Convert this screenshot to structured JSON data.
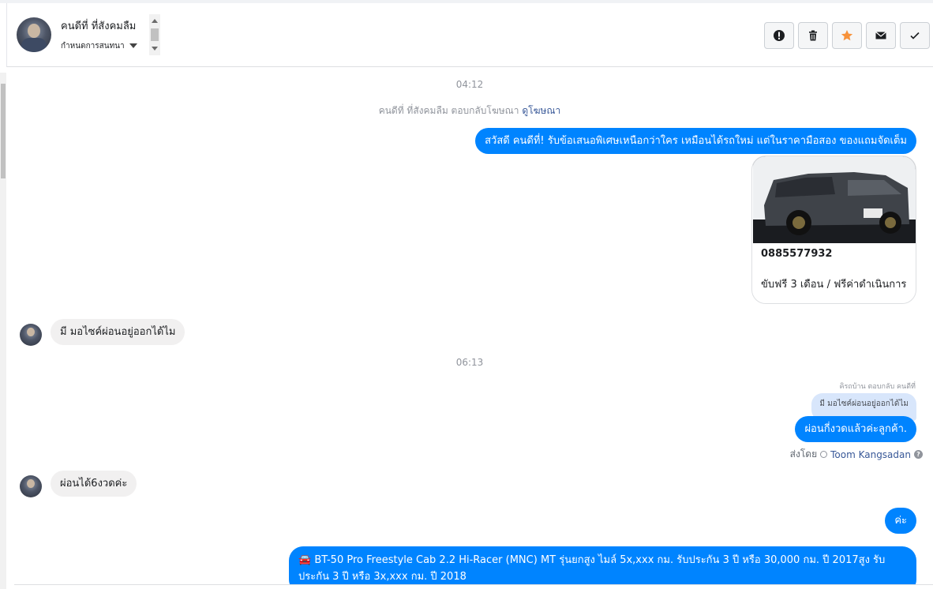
{
  "header": {
    "contact_name": "คนดีที่ ที่สังคมลืม",
    "assign_label": "กำหนดการสนทนา",
    "actions": [
      {
        "name": "spam-button",
        "icon": "exclamation-icon"
      },
      {
        "name": "delete-button",
        "icon": "trash-icon"
      },
      {
        "name": "star-button",
        "icon": "star-icon"
      },
      {
        "name": "mark-unread-button",
        "icon": "envelope-icon"
      },
      {
        "name": "mark-done-button",
        "icon": "check-icon"
      }
    ]
  },
  "colors": {
    "accent": "#0084ff",
    "star": "#f7923b",
    "incoming": "#f1f0f0"
  },
  "conversation": {
    "time1": "04:12",
    "ad_reply_text": "คนดีที่ ที่สังคมลืม ตอบกลับโฆษณา",
    "ad_link": "ดูโฆษณา",
    "msg1": "สวัสดี คนดีที่! รับข้อเสนอพิเศษเหนือกว่าใคร เหมือนได้รถใหม่ แต่ในราคามือสอง ของแถมจัดเต็ม",
    "card": {
      "title": "0885577932",
      "description": "ขับฟรี 3 เดือน / ฟรีค่าดำเนินการ"
    },
    "msg2": "มี มอไซค์ผ่อนอยู่ออกได้ไม",
    "time2": "06:13",
    "reply_meta": "คิรถบ้าน ตอบกลับ คนดีที่",
    "quoted": "มี มอไซค์ผ่อนอยู่ออกได้ไม",
    "msg3": "ผ่อนกี่งวดแล้วค่ะลูกค้า.",
    "sent_by_label": "ส่งโดย",
    "sender": "Toom Kangsadan",
    "msg4": "ผ่อนได้6งวดค่ะ",
    "msg5": "ค่ะ",
    "msg6": "🚘 BT-50 Pro Freestyle Cab 2.2 Hi-Racer (MNC) MT รุ่นยกสูง ไมล์ 5x,xxx กม. รับประกัน 3 ปี หรือ 30,000 กม. ปี 2017สูง รับประกัน 3 ปี หรือ 3x,xxx กม. ปี 2018"
  }
}
